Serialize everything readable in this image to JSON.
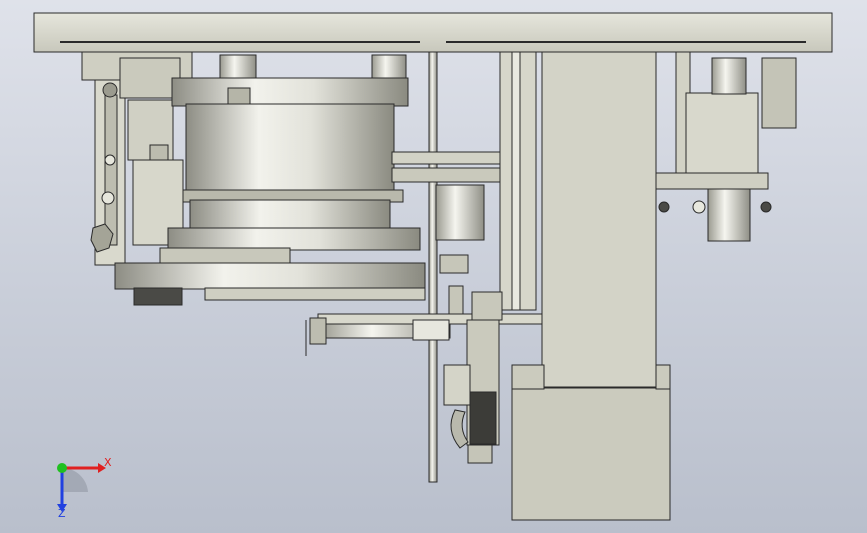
{
  "viewport": {
    "background_top": "#dfe2ea",
    "background_bottom": "#b9bfcc"
  },
  "model": {
    "part_fill": "#d5d5c8",
    "part_stroke": "#2a2a2a",
    "metal_light": "#f4f4ee",
    "metal_dark": "#8e8e84"
  },
  "triad": {
    "x_label": "X",
    "z_label": "Z",
    "x_color": "#e02020",
    "y_color": "#20c020",
    "z_color": "#2040e0"
  }
}
